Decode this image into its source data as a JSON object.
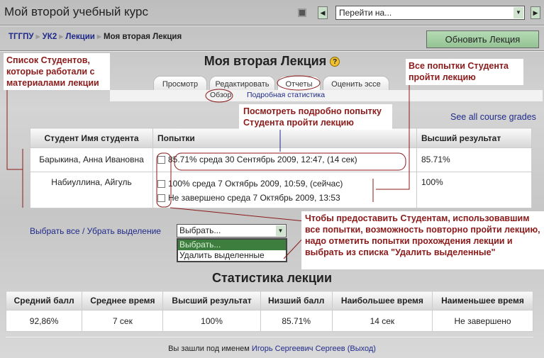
{
  "header": {
    "course_title": "Мой второй учебный курс",
    "jump_placeholder": "Перейти на..."
  },
  "breadcrumb": [
    "ТГГПУ",
    "УК2",
    "Лекции",
    "Моя вторая Лекция"
  ],
  "update_button": "Обновить Лекция",
  "page_title": "Моя вторая Лекция",
  "tabs": [
    "Просмотр",
    "Редактировать",
    "Отчеты",
    "Оценить эссе"
  ],
  "subtabs": [
    "Обзор",
    "Подробная статистика"
  ],
  "grades_link": "See all course grades",
  "attempts_table": {
    "headers": [
      "Студент Имя студента",
      "Попытки",
      "Высший результат"
    ],
    "rows": [
      {
        "student": "Барыкина, Анна Ивановна",
        "attempts": [
          "85.71% среда 30 Сентябрь 2009, 12:47, (14 сек)"
        ],
        "best": "85.71%"
      },
      {
        "student": "Набиуллина, Айгуль",
        "attempts": [
          "100% среда 7 Октябрь 2009, 10:59, (сейчас)",
          "Не завершено среда 7 Октябрь 2009, 13:53"
        ],
        "best": "100%"
      }
    ]
  },
  "select_all": "Выбрать все",
  "separator": "/",
  "deselect": "Убрать выделение",
  "action_select": {
    "value": "Выбрать...",
    "options": [
      "Выбрать...",
      "Удалить выделенные"
    ]
  },
  "stats": {
    "title": "Статистика лекции",
    "headers": [
      "Средний балл",
      "Среднее время",
      "Высший результат",
      "Низший балл",
      "Наибольшее время",
      "Наименьшее время"
    ],
    "values": [
      "92,86%",
      "7 сек",
      "100%",
      "85.71%",
      "14 сек",
      "Не завершено"
    ]
  },
  "footer": {
    "prefix": "Вы зашли под именем",
    "user": "Игорь Сергеевич Сергеев",
    "logout": "(Выход)"
  },
  "annotations": {
    "students": "Список Студентов, которые работали с материалами лекции",
    "all_attempts": "Все попытки Студента пройти лекцию",
    "view_attempt": "Посмотреть подробно попытку Студента пройти лекцию",
    "retake": "Чтобы предоставить Студентам, использовавшим все попытки, возможность повторно пройти лекцию, надо  отметить попытки прохождения лекции  и выбрать из списка \"Удалить выделенные\""
  }
}
